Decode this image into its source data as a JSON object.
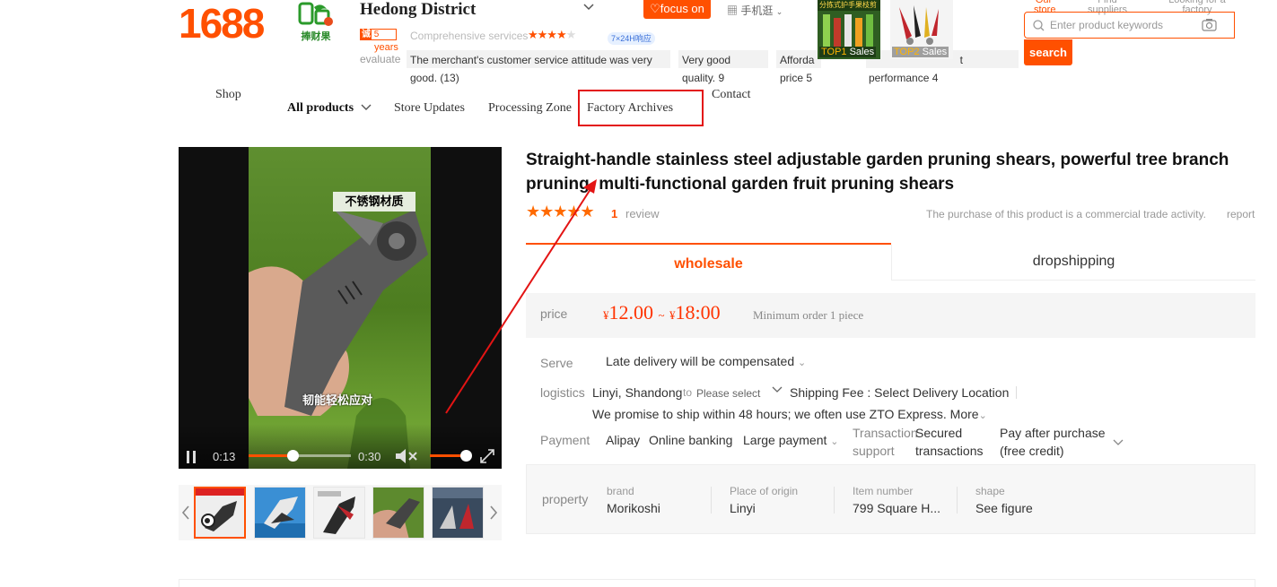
{
  "brand": {
    "logo_text": "1688"
  },
  "shop": {
    "logo_cn": "捧财果",
    "name": "Hedong District",
    "focus_label": "focus on",
    "mobile_label": "手机逛",
    "years_badge_prefix": "诚",
    "years_badge_num": "5",
    "years_label": "years",
    "service_label": "Comprehensive services",
    "service_stars": "★★★★",
    "response_badge": "7×24H响应",
    "evaluate_label": "evaluate",
    "eval_items": [
      {
        "line1": "The merchant's customer service attitude was very",
        "line2": "good. (13)"
      },
      {
        "line1": "Very good",
        "line2": "quality. 9"
      },
      {
        "line1": "Afforda",
        "line2": "price 5"
      },
      {
        "line1": "t",
        "line2": "performance 4"
      }
    ],
    "top_items": [
      {
        "banner": "分拣式护手果枝剪",
        "rank": "TOP1",
        "label": "Sales"
      },
      {
        "banner": "",
        "rank": "TOP2",
        "label": "Sales"
      }
    ]
  },
  "header": {
    "tabs": [
      "Our store",
      "Find suppliers",
      "Looking for a factory"
    ],
    "search_placeholder": "Enter product keywords",
    "search_label": "search"
  },
  "nav": {
    "shop": "Shop",
    "all_products": "All products",
    "store_updates": "Store Updates",
    "processing_zone": "Processing Zone",
    "factory_archives": "Factory Archives",
    "contact": "Contact"
  },
  "gallery": {
    "overlay_top": "不锈钢材质",
    "overlay_bottom": "韧能轻松应对",
    "time_current": "0:13",
    "time_total": "0:30",
    "progress": 0.43,
    "volume": 0.9,
    "thumb_count": 5
  },
  "product": {
    "title": "Straight-handle stainless steel adjustable garden pruning shears, powerful tree branch pruning, multi-functional garden fruit pruning shears",
    "stars": "★★★★★",
    "review_count": "1",
    "review_label": "review",
    "trade_note": "The purchase of this product is a commercial trade activity.",
    "report": "report",
    "tab_wholesale": "wholesale",
    "tab_dropshipping": "dropshipping",
    "price_label": "price",
    "currency": "¥",
    "price_low": "12.00",
    "price_sep": "~",
    "price_high": "18:00",
    "min_order": "Minimum order 1 piece",
    "serve_label": "Serve",
    "serve_value": "Late delivery will be compensated",
    "logistics_label": "logistics",
    "logistics_origin": "Linyi, Shandong",
    "logistics_to": "to",
    "logistics_select": "Please select",
    "shipping_fee": "Shipping Fee : Select Delivery Location",
    "logistics_promise": "We promise to ship within 48 hours; we often use ZTO Express. More",
    "payment_label": "Payment",
    "payment_alipay": "Alipay",
    "payment_online": "Online banking",
    "payment_large": "Large payment",
    "transaction_label_1": "Transaction",
    "transaction_label_2": "support",
    "secured_1": "Secured",
    "secured_2": "transactions",
    "pay_after_1": "Pay after purchase",
    "pay_after_2": "(free credit)",
    "property_label": "property",
    "properties": [
      {
        "k": "brand",
        "v": "Morikoshi"
      },
      {
        "k": "Place of origin",
        "v": "Linyi"
      },
      {
        "k": "Item number",
        "v": "799 Square H..."
      },
      {
        "k": "shape",
        "v": "See figure"
      }
    ]
  },
  "colors": {
    "accent": "#ff5000",
    "highlight": "#e31414"
  }
}
